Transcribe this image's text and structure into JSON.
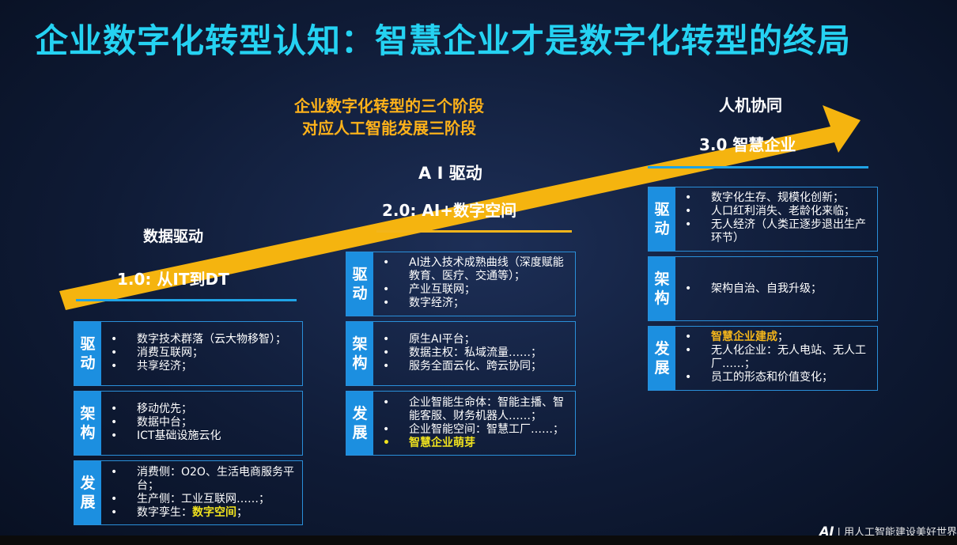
{
  "title": "企业数字化转型认知：智慧企业才是数字化转型的终局",
  "center_caption": {
    "line1": "企业数字化转型的三个阶段",
    "line2": "对应人工智能发展三阶段"
  },
  "stages": [
    {
      "name": "数据驱动",
      "label": "1.0: 从IT到DT"
    },
    {
      "name": "A I 驱动",
      "label": "2.0: AI+数字空间"
    },
    {
      "name": "人机协同",
      "label": "3.0 智慧企业"
    }
  ],
  "tags": {
    "drive": [
      "驱",
      "动"
    ],
    "arch": [
      "架",
      "构"
    ],
    "develop": [
      "发",
      "展"
    ]
  },
  "col1": {
    "drive": [
      "数字技术群落（云大物移智）；",
      "消费互联网；",
      "共享经济；"
    ],
    "arch": [
      "移动优先；",
      "数据中台；",
      "ICT基础设施云化"
    ],
    "develop": [
      "消费侧：O2O、生活电商服务平台；",
      "生产侧：工业互联网……；"
    ],
    "develop_last_prefix": "数字孪生：",
    "develop_last_hl": "数字空间",
    "develop_last_suffix": "；"
  },
  "col2": {
    "drive": [
      "AI进入技术成熟曲线（深度赋能教育、医疗、交通等）；",
      "产业互联网；",
      "数字经济；"
    ],
    "arch": [
      "原生AI平台；",
      "数据主权：私域流量……；",
      "服务全面云化、跨云协同；"
    ],
    "develop": [
      "企业智能生命体：智能主播、智能客服、财务机器人……；",
      "企业智能空间：智慧工厂……；"
    ],
    "develop_hl": "智慧企业萌芽"
  },
  "col3": {
    "drive": [
      "数字化生存、规模化创新；",
      "人口红利消失、老龄化来临；",
      "无人经济（人类正逐步退出生产环节）"
    ],
    "arch": [
      "架构自治、自我升级；"
    ],
    "develop_hl": "智慧企业建成",
    "develop_hl_suffix": "；",
    "develop": [
      "无人化企业：无人电站、无人工厂……；",
      "员工的形态和价值变化；"
    ]
  },
  "brand": {
    "logo": "AI",
    "text": "| 用人工智能建设美好世界"
  },
  "colors": {
    "title": "#25d2f2",
    "arrow": "#f5b40f",
    "tag_bg": "#1c8fe0",
    "highlight": "#f0e21e"
  }
}
